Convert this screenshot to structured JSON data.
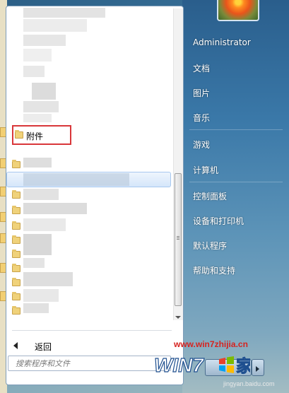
{
  "start_menu": {
    "programs": {
      "accessories_label": "附件",
      "back_label": "返回"
    },
    "search": {
      "placeholder": "搜索程序和文件"
    },
    "right_pane": {
      "user_name": "Administrator",
      "items": [
        {
          "label": "文档"
        },
        {
          "label": "图片"
        },
        {
          "label": "音乐"
        },
        {
          "label": "游戏"
        },
        {
          "label": "计算机"
        },
        {
          "label": "控制面板"
        },
        {
          "label": "设备和打印机"
        },
        {
          "label": "默认程序"
        },
        {
          "label": "帮助和支持"
        }
      ]
    }
  },
  "watermark": {
    "url": "www.win7zhijia.cn",
    "logo_text": "WIN7",
    "logo_suffix": "家",
    "sub": "jingyan.baidu.com"
  },
  "colors": {
    "highlight_border": "#d9373a",
    "watermark_red": "#d6231f"
  },
  "icons": {
    "user_picture": "flower-picture",
    "back": "triangle-left-icon",
    "folder": "folder-icon",
    "shutdown_arrow": "triangle-right-icon"
  }
}
